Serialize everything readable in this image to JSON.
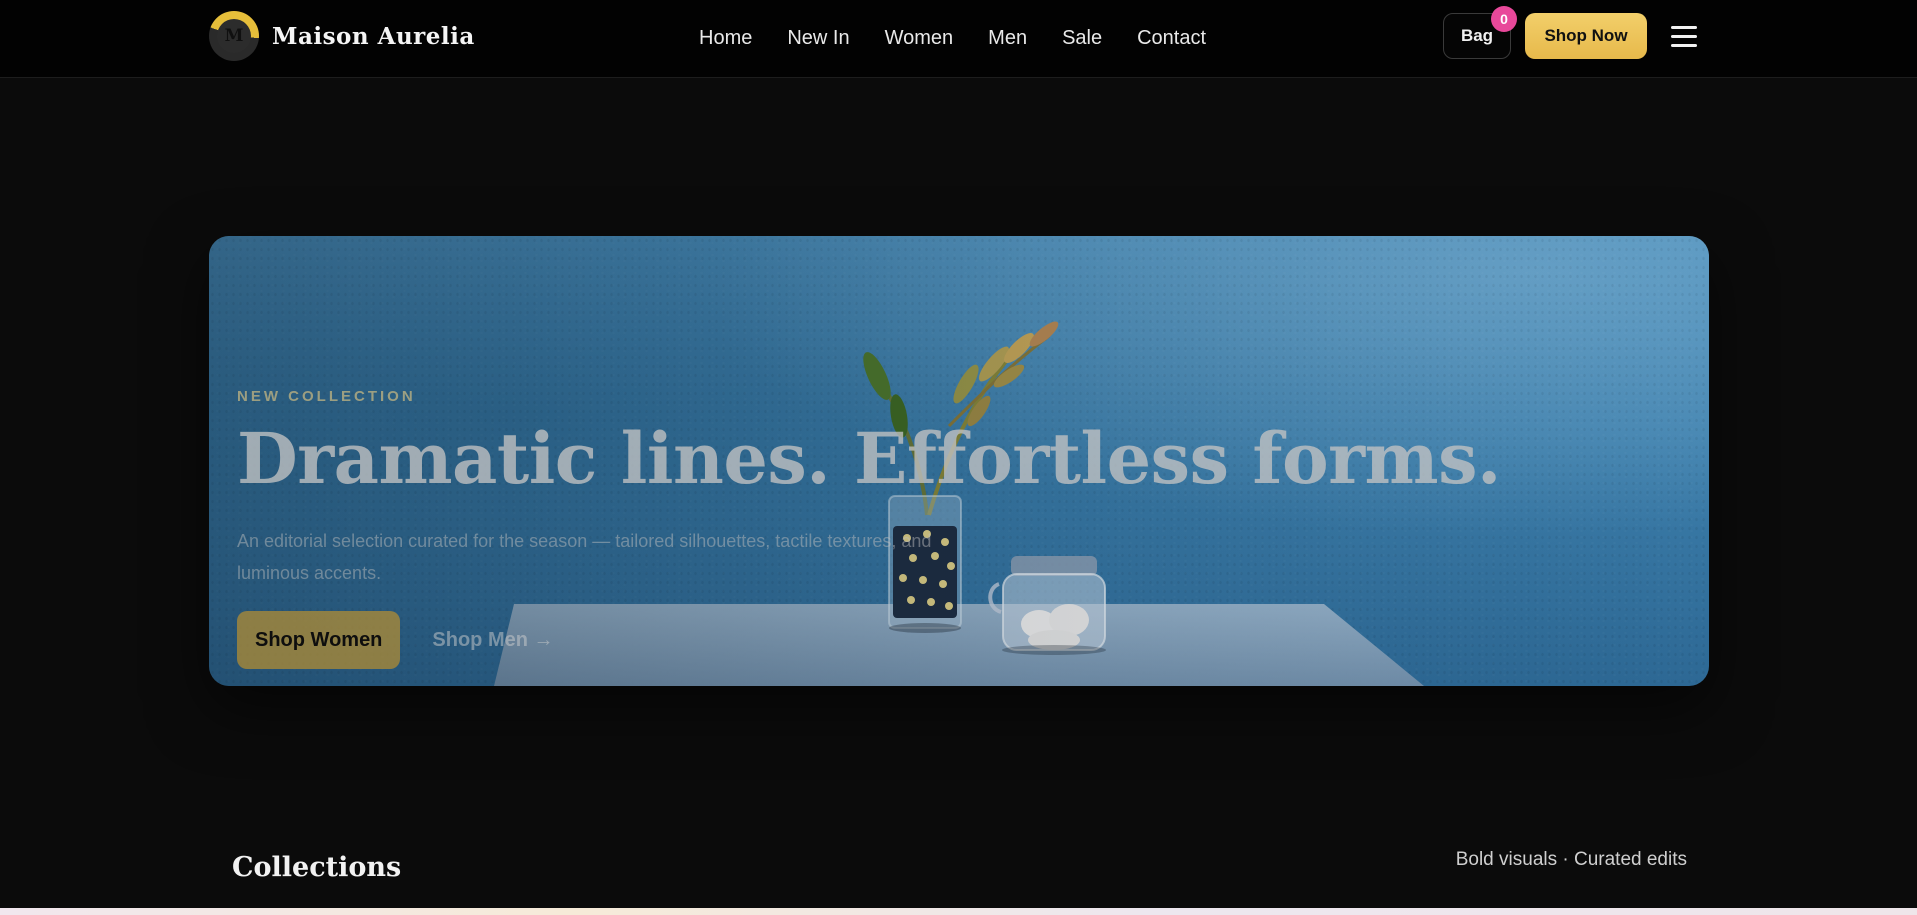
{
  "brand": {
    "logo_letter": "M",
    "name": "Maison Aurelia"
  },
  "nav": {
    "items": [
      "Home",
      "New In",
      "Women",
      "Men",
      "Sale",
      "Contact"
    ]
  },
  "header_actions": {
    "bag_label": "Bag",
    "bag_count": "0",
    "shop_now_label": "Shop Now",
    "menu_icon": "hamburger-menu-icon"
  },
  "hero": {
    "eyebrow": "NEW COLLECTION",
    "title": "Dramatic lines. Effortless forms.",
    "subtitle": "An editorial selection curated for the season — tailored silhouettes, tactile textures, and luminous accents.",
    "primary_cta": "Shop Women",
    "secondary_cta": "Shop Men →",
    "image_semantic": "blue-wall-plant-vase-jar-photo"
  },
  "collections": {
    "title": "Collections",
    "note": "Bold visuals · Curated edits"
  },
  "colors": {
    "accent_gold": "#e7b94b",
    "badge_pink": "#e8489a",
    "background": "#0b0b0b",
    "header": "#020202"
  }
}
